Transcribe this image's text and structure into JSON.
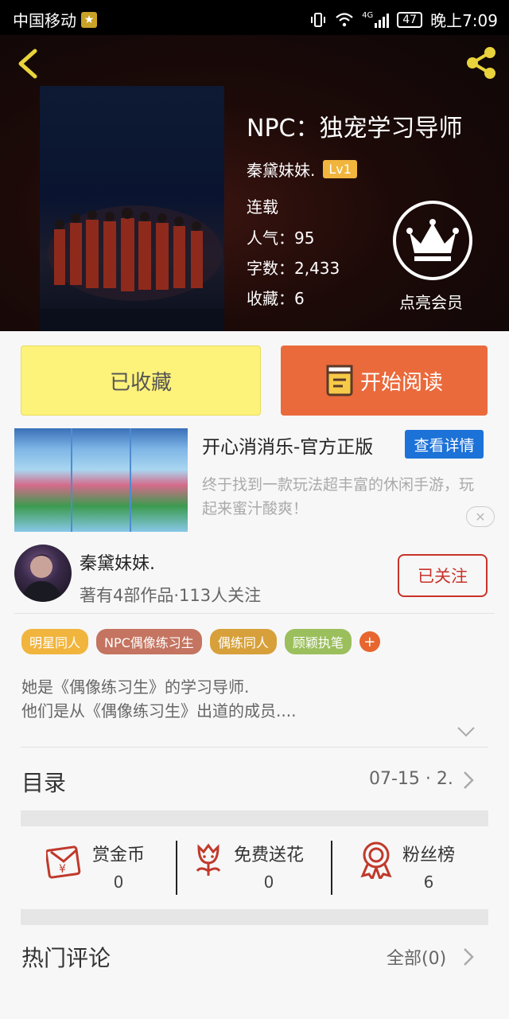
{
  "status_bar": {
    "carrier": "中国移动",
    "network": "4G",
    "battery": "47",
    "time": "晚上7:09"
  },
  "book": {
    "title": "NPC：独宠学习导师",
    "author": "秦黛妹妹.",
    "author_level": "Lv1",
    "status": "连载",
    "popularity": "人气：95",
    "word_count": "字数：2,433",
    "favorites": "收藏：6",
    "member_label": "点亮会员"
  },
  "actions": {
    "collected_label": "已收藏",
    "read_label": "开始阅读"
  },
  "ad": {
    "title": "开心消消乐-官方正版",
    "detail_button": "查看详情",
    "description": "终于找到一款玩法超丰富的休闲手游，玩起来蜜汁酸爽！",
    "close_glyph": "✕"
  },
  "author": {
    "name": "秦黛妹妹.",
    "meta": "著有4部作品·113人关注",
    "follow_label": "已关注"
  },
  "tags": [
    {
      "label": "明星同人",
      "color": "#f1b53d"
    },
    {
      "label": "NPC偶像练习生",
      "color": "#c47460"
    },
    {
      "label": "偶练同人",
      "color": "#d7a03a"
    },
    {
      "label": "顾颖执笔",
      "color": "#9bbf5c"
    }
  ],
  "tag_add_glyph": "+",
  "description": {
    "line1": "她是《偶像练习生》的学习导师.",
    "line2": "他们是从《偶像练习生》出道的成员...."
  },
  "catalog": {
    "label": "目录",
    "latest": "07-15 · 2."
  },
  "rewards": [
    {
      "label": "赏金币",
      "count": "0"
    },
    {
      "label": "免费送花",
      "count": "0"
    },
    {
      "label": "粉丝榜",
      "count": "6"
    }
  ],
  "comments": {
    "label": "热门评论",
    "all_label": "全部(0)"
  },
  "colors": {
    "accent_orange": "#ea6a3c",
    "collected_yellow": "#fdf27a",
    "follow_red": "#c9322a",
    "ad_blue": "#1d72d8",
    "icon_red": "#c0392b"
  }
}
